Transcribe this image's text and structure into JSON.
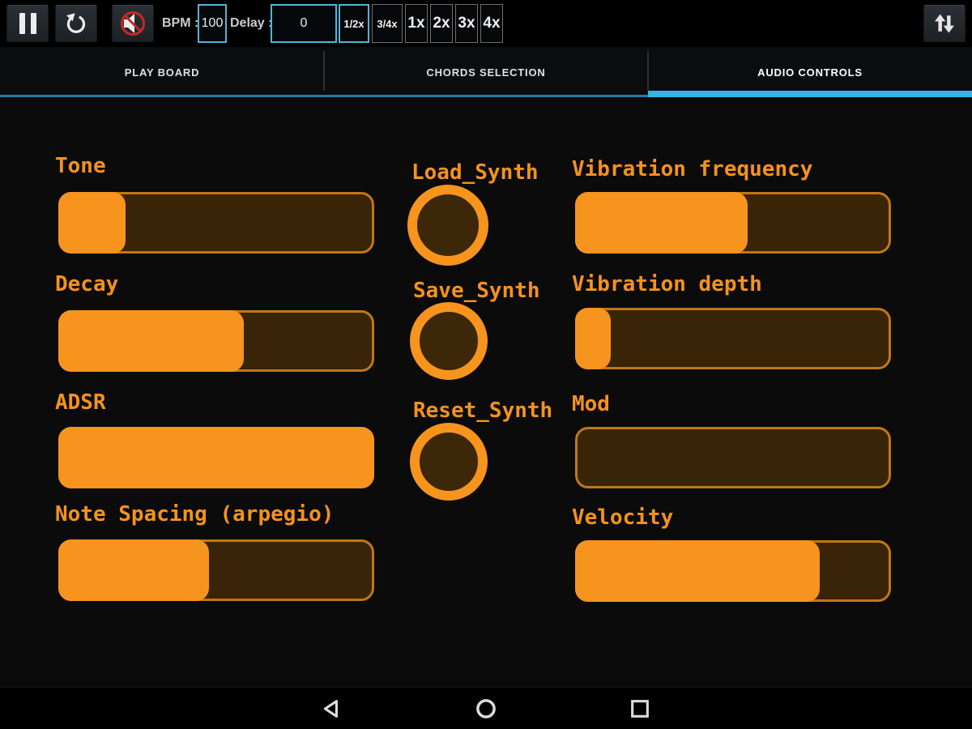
{
  "toolbar": {
    "bpm_label": "BPM :",
    "bpm_value": "100",
    "delay_label": "Delay :",
    "delay_value": "0",
    "speed_options": [
      {
        "label": "1/2x",
        "selected": true
      },
      {
        "label": "3/4x",
        "selected": false
      },
      {
        "label": "1x",
        "selected": false
      },
      {
        "label": "2x",
        "selected": false
      },
      {
        "label": "3x",
        "selected": false
      },
      {
        "label": "4x",
        "selected": false
      }
    ],
    "icons": [
      "pause-icon",
      "replay-icon",
      "mute-speaker-icon",
      "swap-vertical-icon"
    ]
  },
  "tabs": [
    {
      "label": "PLAY BOARD",
      "active": false
    },
    {
      "label": "CHORDS SELECTION",
      "active": false
    },
    {
      "label": "AUDIO CONTROLS",
      "active": true
    }
  ],
  "audio_controls": {
    "left_sliders": [
      {
        "label": "Tone",
        "value_pct": 20
      },
      {
        "label": "Decay",
        "value_pct": 58
      },
      {
        "label": "ADSR",
        "value_pct": 100
      },
      {
        "label": "Note Spacing (arpegio)",
        "value_pct": 47
      }
    ],
    "synth_buttons": [
      {
        "label": "Load_Synth"
      },
      {
        "label": "Save_Synth"
      },
      {
        "label": "Reset_Synth"
      }
    ],
    "right_sliders": [
      {
        "label": "Vibration frequency",
        "value_pct": 54
      },
      {
        "label": "Vibration depth",
        "value_pct": 10
      },
      {
        "label": "Mod",
        "value_pct": 0
      },
      {
        "label": "Velocity",
        "value_pct": 77
      }
    ]
  },
  "navigation_bar": {
    "icons": [
      "back-icon",
      "home-icon",
      "recents-icon"
    ]
  },
  "colors": {
    "accent_blue": "#33b5e5",
    "orange_fill": "#f7941e",
    "slider_track": "#3a2407",
    "slider_border": "#bf7815",
    "mute_red": "#c62828"
  }
}
